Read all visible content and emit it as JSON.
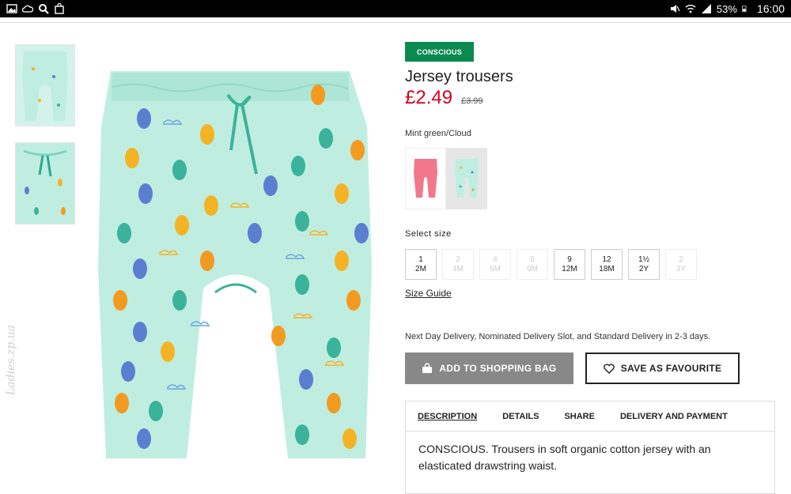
{
  "status_bar": {
    "battery": "53%",
    "time": "16:00"
  },
  "product": {
    "badge": "CONSCIOUS",
    "title": "Jersey trousers",
    "price": "£2.49",
    "old_price": "£3.99",
    "color": "Mint green/Cloud"
  },
  "sizes": {
    "label": "Select size",
    "options": [
      {
        "line1": "1",
        "line2": "2M",
        "available": true
      },
      {
        "line1": "2",
        "line2": "4M",
        "available": false
      },
      {
        "line1": "4",
        "line2": "6M",
        "available": false
      },
      {
        "line1": "6",
        "line2": "9M",
        "available": false
      },
      {
        "line1": "9",
        "line2": "12M",
        "available": true
      },
      {
        "line1": "12",
        "line2": "18M",
        "available": true
      },
      {
        "line1": "1½",
        "line2": "2Y",
        "available": true
      },
      {
        "line1": "2",
        "line2": "3Y",
        "available": false
      }
    ],
    "guide": "Size Guide"
  },
  "delivery_text": "Next Day Delivery, Nominated Delivery Slot, and Standard Delivery in 2-3 days.",
  "buttons": {
    "bag": "ADD TO SHOPPING BAG",
    "favourite": "SAVE AS FAVOURITE"
  },
  "tabs": [
    "DESCRIPTION",
    "DETAILS",
    "SHARE",
    "DELIVERY AND PAYMENT"
  ],
  "description": "CONSCIOUS. Trousers in soft organic cotton jersey with an elasticated drawstring waist.",
  "watermark": "Ladies.zp.ua",
  "colors": {
    "badge": "#0b8a50",
    "price": "#d6001c",
    "mint": "#bfeee0",
    "pink": "#f2778a"
  }
}
